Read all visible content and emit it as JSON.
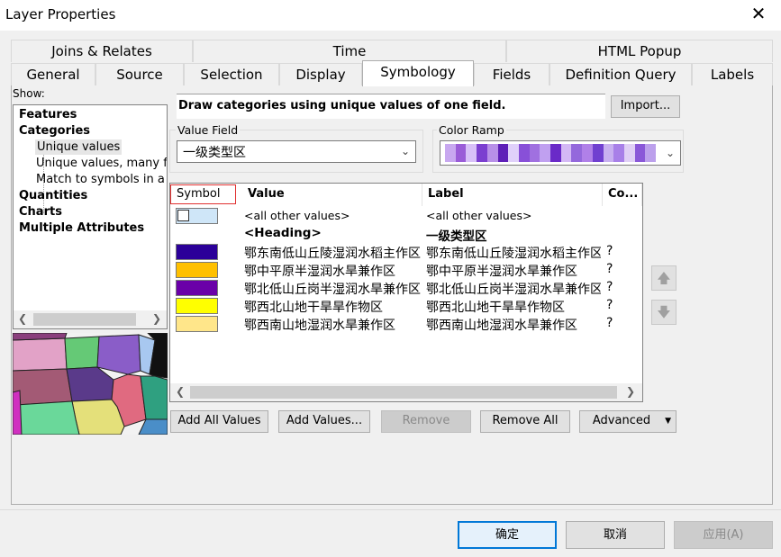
{
  "window": {
    "title": "Layer Properties",
    "close": "✕"
  },
  "tabs_top": [
    "Joins & Relates",
    "Time",
    "HTML Popup"
  ],
  "tabs_bottom": [
    "General",
    "Source",
    "Selection",
    "Display",
    "Symbology",
    "Fields",
    "Definition Query",
    "Labels"
  ],
  "active_tab": "Symbology",
  "show": {
    "label": "Show:",
    "items": [
      {
        "label": "Features",
        "bold": true
      },
      {
        "label": "Categories",
        "bold": true
      },
      {
        "label": "Unique values",
        "bold": false,
        "selected": true
      },
      {
        "label": "Unique values, many fields",
        "bold": false
      },
      {
        "label": "Match to symbols in a style",
        "bold": false
      },
      {
        "label": "Quantities",
        "bold": true
      },
      {
        "label": "Charts",
        "bold": true
      },
      {
        "label": "Multiple Attributes",
        "bold": true
      }
    ]
  },
  "description": "Draw categories using unique values of one field.",
  "import_button": "Import...",
  "value_field": {
    "label": "Value Field",
    "value": "一级类型区"
  },
  "color_ramp": {
    "label": "Color Ramp",
    "colors": [
      "#c8a8f0",
      "#9a5cd8",
      "#d8c0f8",
      "#7b3fd0",
      "#b890e8",
      "#5e1fb8",
      "#e0d0fa",
      "#8850d8",
      "#a070e0",
      "#c0a0f0",
      "#6a2ac8",
      "#d4b8f5",
      "#9468dc",
      "#b080e8",
      "#7040d0",
      "#c8b0f0",
      "#a880e8",
      "#e0d0f5",
      "#8a58d8",
      "#bca0ec"
    ]
  },
  "table": {
    "headers": {
      "symbol": "Symbol",
      "value": "Value",
      "label": "Label",
      "count": "Co..."
    },
    "rows": [
      {
        "color": "#cfe6f8",
        "value": "<all other values>",
        "label": "<all other values>",
        "count": "",
        "kind": "other"
      },
      {
        "color": "",
        "value": "<Heading>",
        "label": "一级类型区",
        "count": "",
        "kind": "heading"
      },
      {
        "color": "#2b0099",
        "value": "鄂东南低山丘陵湿润水稻主作区",
        "label": "鄂东南低山丘陵湿润水稻主作区",
        "count": "?",
        "kind": "row"
      },
      {
        "color": "#ffc000",
        "value": "鄂中平原半湿润水旱兼作区",
        "label": "鄂中平原半湿润水旱兼作区",
        "count": "?",
        "kind": "row"
      },
      {
        "color": "#6a00a8",
        "value": "鄂北低山丘岗半湿润水旱兼作区",
        "label": "鄂北低山丘岗半湿润水旱兼作区",
        "count": "?",
        "kind": "row"
      },
      {
        "color": "#ffff00",
        "value": "鄂西北山地干旱旱作物区",
        "label": "鄂西北山地干旱旱作物区",
        "count": "?",
        "kind": "row"
      },
      {
        "color": "#ffe68a",
        "value": "鄂西南山地湿润水旱兼作区",
        "label": "鄂西南山地湿润水旱兼作区",
        "count": "?",
        "kind": "row"
      }
    ]
  },
  "action_buttons": {
    "add_all": "Add All Values",
    "add": "Add Values...",
    "remove": "Remove",
    "remove_all": "Remove All",
    "advanced": "Advanced"
  },
  "footer": {
    "ok": "确定",
    "cancel": "取消",
    "apply": "应用(A)"
  }
}
